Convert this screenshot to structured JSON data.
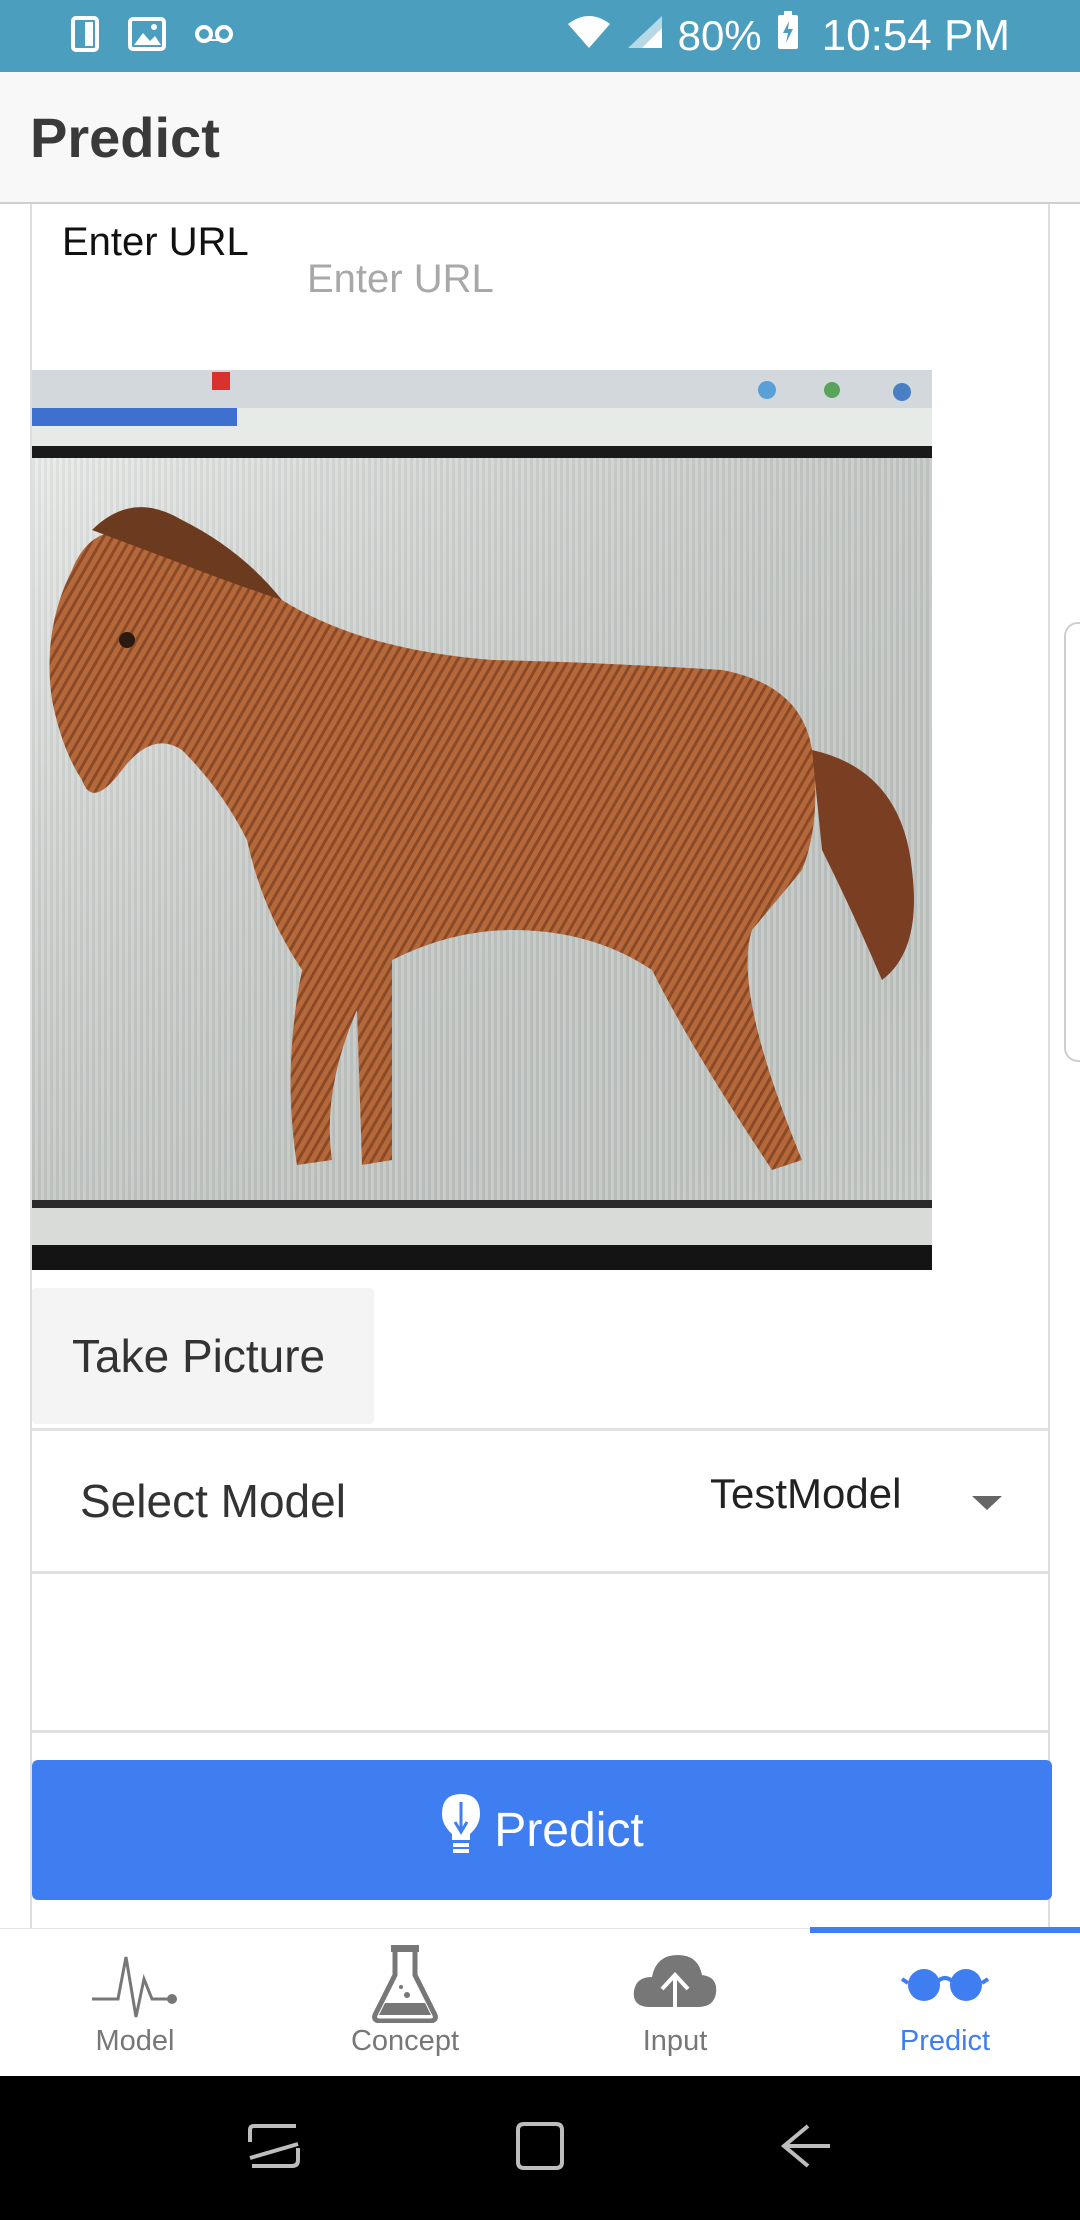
{
  "status_bar": {
    "battery_percent": "80%",
    "time": "10:54 PM",
    "icons": [
      "sim-card-icon",
      "image-icon",
      "voicemail-icon",
      "wifi-icon",
      "cell-signal-icon",
      "battery-charging-icon"
    ]
  },
  "app_bar": {
    "title": "Predict"
  },
  "form": {
    "url_label": "Enter URL",
    "url_value": "",
    "url_placeholder": "Enter URL",
    "take_picture_label": "Take Picture",
    "select_model_label": "Select Model",
    "selected_model": "TestModel",
    "predict_button_label": "Predict"
  },
  "bottom_nav": {
    "items": [
      {
        "label": "Model",
        "icon": "pulse-icon",
        "active": false
      },
      {
        "label": "Concept",
        "icon": "flask-icon",
        "active": false
      },
      {
        "label": "Input",
        "icon": "cloud-upload-icon",
        "active": false
      },
      {
        "label": "Predict",
        "icon": "glasses-icon",
        "active": true
      }
    ]
  },
  "system_nav": {
    "icons": [
      "recents-icon",
      "home-icon",
      "back-icon"
    ]
  },
  "colors": {
    "status_bar": "#4b9ebd",
    "accent": "#3f7ef0",
    "inactive_nav": "#777777"
  }
}
